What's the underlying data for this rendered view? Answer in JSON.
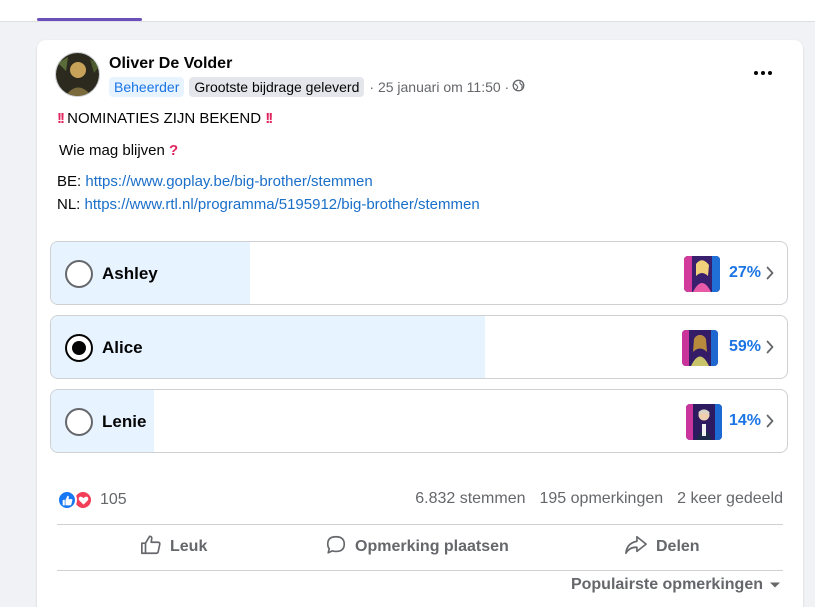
{
  "post": {
    "author": "Oliver De Volder",
    "badges": {
      "admin": "Beheerder",
      "contributor": "Grootste bijdrage geleverd"
    },
    "timestamp": "· 25 januari om 11:50 ·",
    "line1": "NOMINATIES ZIJN BEKEND",
    "line2": "Wie mag blijven",
    "be_prefix": "BE:",
    "be_link": "https://www.goplay.be/big-brother/stemmen",
    "nl_prefix": "NL:",
    "nl_link": "https://www.rtl.nl/programma/5195912/big-brother/stemmen"
  },
  "poll": {
    "options": [
      {
        "name": "Ashley",
        "percent_label": "27%",
        "share": 0.27,
        "selected": false
      },
      {
        "name": "Alice",
        "percent_label": "59%",
        "share": 0.59,
        "selected": true
      },
      {
        "name": "Lenie",
        "percent_label": "14%",
        "share": 0.14,
        "selected": false
      }
    ]
  },
  "stats": {
    "reaction_count": "105",
    "votes": "6.832 stemmen",
    "comments": "195 opmerkingen",
    "shares": "2 keer gedeeld"
  },
  "actions": {
    "like": "Leuk",
    "comment": "Opmerking plaatsen",
    "share": "Delen"
  },
  "sort": {
    "label": "Populairste opmerkingen"
  },
  "colors": {
    "accent": "#1b74e4",
    "poll_fill": "#e7f3ff",
    "like_blue": "#1877f2",
    "love_red": "#f33e58",
    "exclamation_red": "#e0245e"
  },
  "icons": {
    "globe": "globe-icon",
    "more": "more-options-icon",
    "like": "thumbs-up-icon",
    "comment": "comment-bubble-icon",
    "share": "share-arrow-icon",
    "sort": "caret-down-icon",
    "chevron": "chevron-right-icon"
  }
}
